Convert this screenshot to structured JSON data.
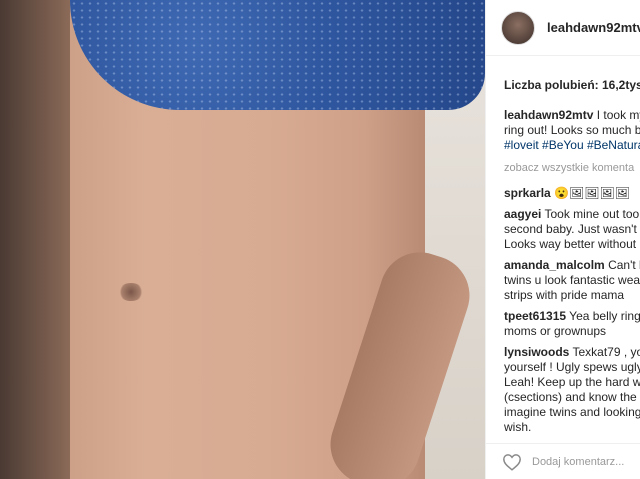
{
  "post": {
    "username": "leahdawn92mtv",
    "likes_label": "Liczba polubień: 16,2tys.",
    "caption": {
      "author": "leahdawn92mtv",
      "line1": "I took my",
      "line2": "ring out! Looks so much b",
      "line3": "#loveit #BeYou #BeNatura"
    },
    "view_all": "zobacz wszystkie komenta",
    "comments": [
      {
        "author": "sprkarla",
        "text": "😮🖼🖼🖼🖼"
      },
      {
        "author": "aagyei",
        "text": "Took mine out too\nsecond baby. Just wasn't t\nLooks way better without i"
      },
      {
        "author": "amanda_malcolm",
        "text": "Can't b\ntwins u look fantastic wear\nstrips with pride mama"
      },
      {
        "author": "tpeet61315",
        "text": "Yea belly rings\nmoms or grownups"
      },
      {
        "author": "lynsiwoods",
        "text": "Texkat79 , you\nyourself ! Ugly spews ugly\nLeah! Keep up the hard wo\n(csections) and know the s\nimagine twins and looking\nwish."
      }
    ],
    "add_comment_placeholder": "Dodaj komentarz..."
  }
}
